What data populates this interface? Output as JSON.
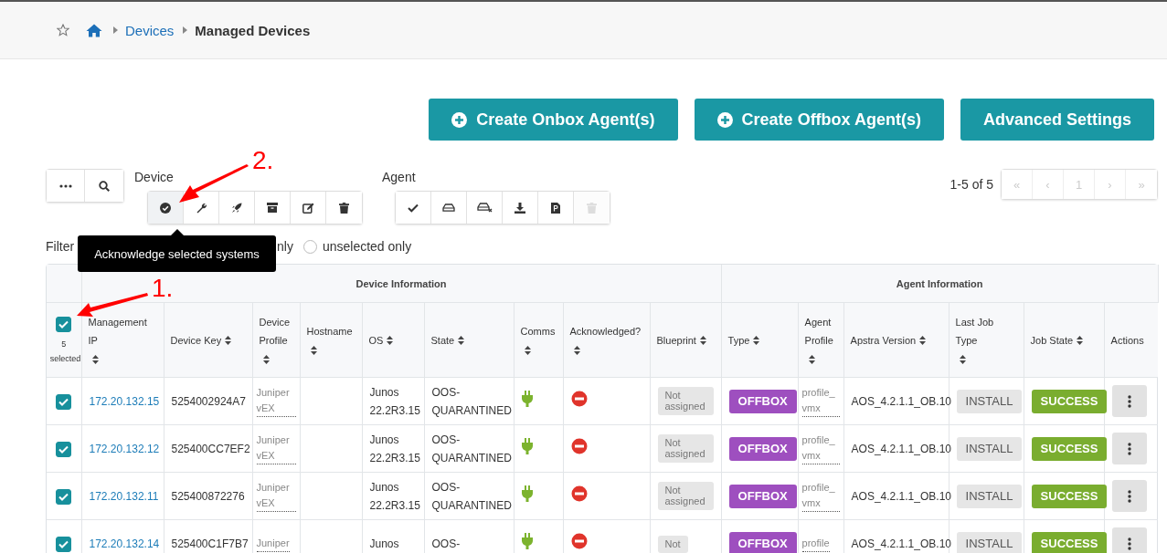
{
  "breadcrumb": {
    "items": [
      {
        "label": "Devices",
        "kind": "link"
      },
      {
        "label": "Managed Devices",
        "kind": "current"
      }
    ]
  },
  "actions": [
    {
      "label": "Create Onbox Agent(s)",
      "kind": "plus"
    },
    {
      "label": "Create Offbox Agent(s)",
      "kind": "plus"
    },
    {
      "label": "Advanced Settings",
      "kind": "plain"
    }
  ],
  "toolbar": {
    "tools": [
      {
        "kind": "more"
      },
      {
        "kind": "search"
      }
    ],
    "groups": [
      {
        "title": "Device",
        "buttons": [
          {
            "kind": "check-circle",
            "hovered": true,
            "disabled": false
          },
          {
            "kind": "wrench",
            "hovered": false,
            "disabled": false
          },
          {
            "kind": "rocket",
            "hovered": false,
            "disabled": false
          },
          {
            "kind": "archive",
            "hovered": false,
            "disabled": false
          },
          {
            "kind": "edit",
            "hovered": false,
            "disabled": false
          },
          {
            "kind": "trash",
            "hovered": false,
            "disabled": false
          }
        ]
      },
      {
        "title": "Agent",
        "buttons": [
          {
            "kind": "check",
            "hovered": false,
            "disabled": false
          },
          {
            "kind": "drive",
            "hovered": false,
            "disabled": false
          },
          {
            "kind": "drive-x",
            "hovered": false,
            "disabled": false
          },
          {
            "kind": "download",
            "hovered": false,
            "disabled": false
          },
          {
            "kind": "file",
            "hovered": false,
            "disabled": false
          },
          {
            "kind": "trash",
            "hovered": false,
            "disabled": true
          }
        ]
      }
    ]
  },
  "pagination": {
    "summary": "1-5 of 5",
    "buttons": [
      "«",
      "‹",
      "1",
      "›",
      "»"
    ]
  },
  "tooltip": {
    "text": "Acknowledge selected systems"
  },
  "filter": {
    "label": "Filter",
    "options": [
      {
        "label": "nly",
        "kind": "covered"
      },
      {
        "label": "unselected only",
        "kind": "radio",
        "selected": false
      }
    ]
  },
  "table": {
    "groups": [
      {
        "kind": "spacer"
      },
      {
        "label": "Device Information",
        "kind": "device"
      },
      {
        "label": "Agent Information",
        "kind": "agent"
      },
      {
        "kind": "spacer"
      }
    ],
    "select_all": {
      "checked": true,
      "caption": "5 selected"
    },
    "columns": [
      {
        "label": "Management IP",
        "sortable": true
      },
      {
        "label": "Device Key",
        "sortable": true
      },
      {
        "label": "Device Profile",
        "sortable": true
      },
      {
        "label": "Hostname",
        "sortable": true
      },
      {
        "label": "OS",
        "sortable": true
      },
      {
        "label": "State",
        "sortable": true
      },
      {
        "label": "Comms",
        "sortable": true
      },
      {
        "label": "Acknowledged?",
        "sortable": true
      },
      {
        "label": "Blueprint",
        "sortable": true
      },
      {
        "label": "Type",
        "sortable": true
      },
      {
        "label": "Agent Profile",
        "sortable": true
      },
      {
        "label": "Apstra Version",
        "sortable": true
      },
      {
        "label": "Last Job Type",
        "sortable": true
      },
      {
        "label": "Job State",
        "sortable": true
      },
      {
        "label": "Actions",
        "sortable": false
      }
    ],
    "rows": [
      {
        "checked": true,
        "ip": "172.20.132.15",
        "key": "5254002924A7",
        "profile": "Juniper vEX",
        "os": "Junos 22.2R3.15",
        "state": "OOS-QUARANTINED",
        "connected": true,
        "acknowledged": false,
        "blueprint": "Not assigned",
        "type": "OFFBOX",
        "agent_profile": "profile_vmx",
        "version": "AOS_4.2.1.1_OB.10",
        "last_job": "INSTALL",
        "job_state": {
          "text": "SUCCESS",
          "kind": "success"
        }
      },
      {
        "checked": true,
        "ip": "172.20.132.12",
        "key": "525400CC7EF2",
        "profile": "Juniper vEX",
        "os": "Junos 22.2R3.15",
        "state": "OOS-QUARANTINED",
        "connected": true,
        "acknowledged": false,
        "blueprint": "Not assigned",
        "type": "OFFBOX",
        "agent_profile": "profile_vmx",
        "version": "AOS_4.2.1.1_OB.10",
        "last_job": "INSTALL",
        "job_state": {
          "text": "SUCCESS",
          "kind": "success"
        }
      },
      {
        "checked": true,
        "ip": "172.20.132.11",
        "key": "525400872276",
        "profile": "Juniper vEX",
        "os": "Junos 22.2R3.15",
        "state": "OOS-QUARANTINED",
        "connected": true,
        "acknowledged": false,
        "blueprint": "Not assigned",
        "type": "OFFBOX",
        "agent_profile": "profile_vmx",
        "version": "AOS_4.2.1.1_OB.10",
        "last_job": "INSTALL",
        "job_state": {
          "text": "SUCCESS",
          "kind": "success"
        }
      },
      {
        "checked": true,
        "ip": "172.20.132.14",
        "key": "525400C1F7B7",
        "profile": "Juniper",
        "os": "Junos",
        "state": "OOS-",
        "connected": true,
        "acknowledged": false,
        "blueprint": "Not",
        "type": "OFFBOX",
        "agent_profile": "profile",
        "version": "AOS_4.2.1.1_OB.10",
        "last_job": "INSTALL",
        "job_state": {
          "text": "SUCCESS",
          "kind": "success"
        }
      }
    ]
  },
  "annotations": [
    {
      "label": "1.",
      "kind": "select-all"
    },
    {
      "label": "2.",
      "kind": "acknowledge"
    }
  ]
}
